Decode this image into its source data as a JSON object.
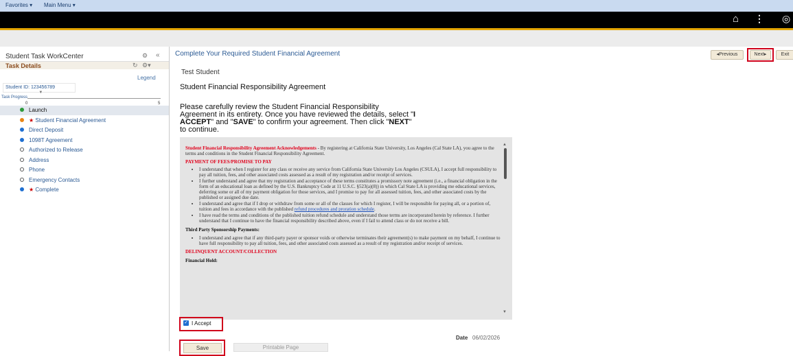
{
  "menu": {
    "favorites": "Favorites ▾",
    "main_menu": "Main Menu ▾"
  },
  "icons": {
    "home": "home-icon",
    "more": "more-vert-icon",
    "navbar": "navbar-icon"
  },
  "left_panel": {
    "title": "Student Task WorkCenter",
    "task_details": "Task Details",
    "legend": "Legend",
    "student_id": "Student ID: 123456789",
    "task_progress": "Task Progress",
    "progress_min": "0",
    "progress_max": "5",
    "progress_value": 0.1,
    "steps": [
      {
        "label": "Launch",
        "status": "done",
        "color": "#2e9a3c",
        "star": ""
      },
      {
        "label": "Student Financial Agreement",
        "status": "current",
        "color": "#e98514",
        "star": "★"
      },
      {
        "label": "Direct Deposit",
        "status": "pending",
        "color": "#1f6fd1",
        "star": ""
      },
      {
        "label": "1098T Agreement",
        "status": "pending",
        "color": "#1f6fd1",
        "star": ""
      },
      {
        "label": "Authorized to Release",
        "status": "optional",
        "color": "",
        "star": ""
      },
      {
        "label": "Address",
        "status": "optional",
        "color": "",
        "star": ""
      },
      {
        "label": "Phone",
        "status": "optional",
        "color": "",
        "star": ""
      },
      {
        "label": "Emergency Contacts",
        "status": "optional",
        "color": "",
        "star": ""
      },
      {
        "label": "Complete",
        "status": "pending",
        "color": "#1f6fd1",
        "star": "★"
      }
    ]
  },
  "main": {
    "title": "Complete Your Required Student Financial Agreement",
    "prev_label": "◂Previous",
    "next_label": "Next▸",
    "exit_label": "Exit",
    "student_name": "Test Student",
    "heading": "Student Financial Responsibility Agreement",
    "instructions": {
      "line1": "Please carefully review the Student Financial Responsibility",
      "line2a": "Agreement in its entirety. Once you have reviewed the details, select \"",
      "line2b": "I",
      "line3a": "ACCEPT",
      "line3b": "\" and \"",
      "line3c": "SAVE",
      "line3d": "\" to confirm your agreement. Then click \"",
      "line3e": "NEXT",
      "line3f": "\"",
      "line4": "to continue."
    },
    "document": {
      "ack_title": "Student Financial Responsibility Agreement Acknowledgements",
      "ack_text": " - By registering at California State University, Los Angeles (Cal State LA), you agree to the terms and conditions in the Student Financial Responsibility Agreement.",
      "payment_heading": "PAYMENT OF FEES/PROMISE TO PAY",
      "payment_items": [
        "I understand that when I register for any class or receive any service from California State University Los Angeles (CSULA), I accept full responsibility to pay all tuition, fees, and other associated costs assessed as a result of my registration and/or receipt of services.",
        "I further understand and agree that my registration and acceptance of these terms constitutes a promissory note agreement (i.e., a financial obligation in the form of an educational loan as defined by the U.S. Bankruptcy Code at 11 U.S.C. §523(a)(8)) in which Cal State LA is providing me educational services, deferring some or all of my payment obligation for those services, and I promise to pay for all assessed tuition, fees, and other associated costs by the published or assigned due date."
      ],
      "drop_text": "I understand and agree that if I drop or withdraw from some or all of the classes for which I register, I will be responsible for paying all, or a portion of, tuition and fees in accordance with the published ",
      "drop_link": "refund procedures and proration schedule",
      "drop_end": ".",
      "refund_text": "I have read the terms and conditions of the published tuition refund schedule and understand those terms are incorporated herein by reference. I further understand that I continue to have the financial responsibility described above, even if I fail to attend class or do not receive a bill.",
      "third_party_heading": "Third Party Sponsorship Payments:",
      "third_party_text": "I understand and agree that if any third-party payer or sponsor voids or otherwise terminates their agreement(s) to make payment on my behalf, I continue to have full responsibility to pay all tuition, fees, and other associated costs assessed as a result of my registration and/or receipt of services.",
      "delinquent_heading": "DELINQUENT ACCOUNT/COLLECTION",
      "financial_hold": "Financial Hold:"
    },
    "accept_label": "I Accept",
    "accept_checked": true,
    "date_label": "Date",
    "date_value": "06/02/2026",
    "save_label": "Save",
    "print_label": "Printable Page"
  }
}
